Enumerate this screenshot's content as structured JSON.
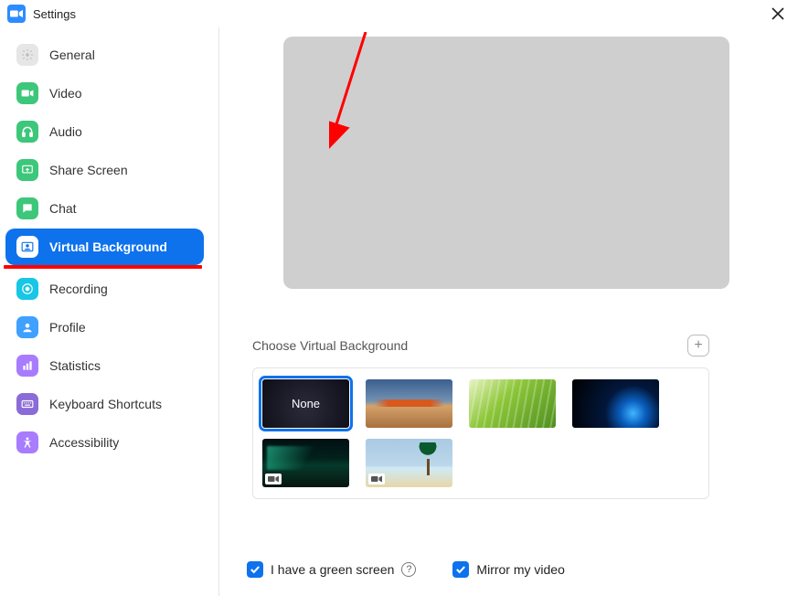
{
  "window": {
    "title": "Settings"
  },
  "sidebar": {
    "items": [
      {
        "label": "General"
      },
      {
        "label": "Video"
      },
      {
        "label": "Audio"
      },
      {
        "label": "Share Screen"
      },
      {
        "label": "Chat"
      },
      {
        "label": "Virtual Background"
      },
      {
        "label": "Recording"
      },
      {
        "label": "Profile"
      },
      {
        "label": "Statistics"
      },
      {
        "label": "Keyboard Shortcuts"
      },
      {
        "label": "Accessibility"
      }
    ],
    "active_index": 5
  },
  "main": {
    "section_title": "Choose Virtual Background",
    "thumbnails": {
      "none_label": "None",
      "selected_index": 0,
      "items": [
        "None",
        "Golden Gate Bridge",
        "Grass",
        "Earth from Space",
        "Aurora",
        "Beach"
      ]
    },
    "checkboxes": {
      "green_screen": {
        "label": "I have a green screen",
        "checked": true
      },
      "mirror": {
        "label": "Mirror my video",
        "checked": true
      }
    }
  }
}
